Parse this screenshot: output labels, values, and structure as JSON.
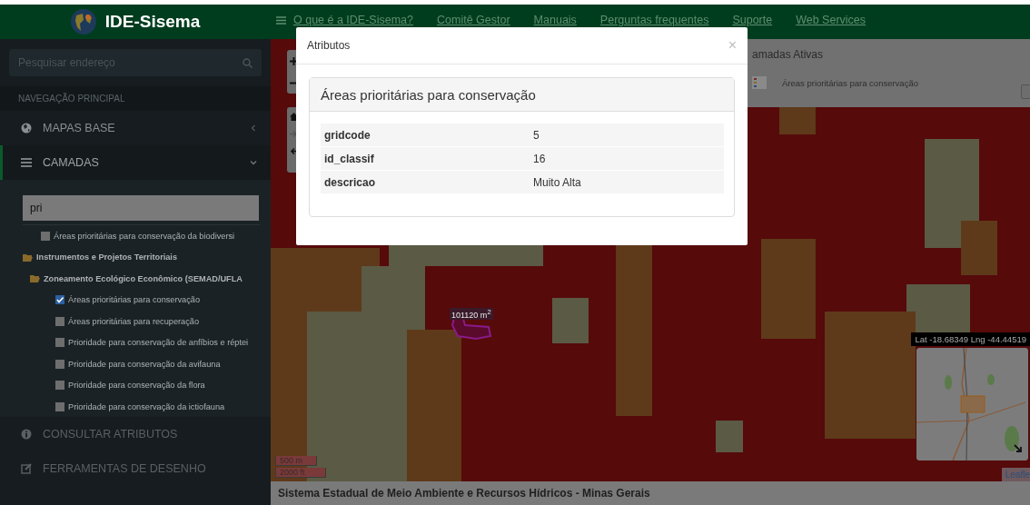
{
  "header": {
    "title": "IDE-Sisema"
  },
  "sidebar": {
    "search": {
      "placeholder": "Pesquisar endereço"
    },
    "section_title": "NAVEGAÇÃO PRINCIPAL",
    "menu": [
      {
        "label": "MAPAS BASE",
        "expanded": false,
        "selected": false
      },
      {
        "label": "CAMADAS",
        "expanded": true,
        "selected": true
      }
    ],
    "layer_filter": {
      "value": "pri"
    },
    "layer_tree": [
      {
        "kind": "layer",
        "label": "Áreas prioritárias para conservação da biodiversi",
        "checked": false
      },
      {
        "kind": "folder",
        "label": "Instrumentos e Projetos Territoriais",
        "children": [
          {
            "kind": "folder",
            "label": "Zoneamento Ecológico Econômico (SEMAD/UFLA",
            "children": [
              {
                "kind": "layer",
                "label": "Áreas prioritárias para conservação",
                "checked": true
              },
              {
                "kind": "layer",
                "label": "Áreas prioritárias para recuperação",
                "checked": false
              },
              {
                "kind": "layer",
                "label": "Prioridade para conservação de anfíbios e réptei",
                "checked": false
              },
              {
                "kind": "layer",
                "label": "Prioridade para conservação da avifauna",
                "checked": false
              },
              {
                "kind": "layer",
                "label": "Prioridade para conservação da flora",
                "checked": false
              },
              {
                "kind": "layer",
                "label": "Prioridade para conservação da ictiofauna",
                "checked": false
              }
            ]
          }
        ]
      }
    ],
    "tools": [
      {
        "label": "CONSULTAR ATRIBUTOS"
      },
      {
        "label": "FERRAMENTAS DE DESENHO"
      }
    ]
  },
  "navbar": {
    "links": [
      "O que é a IDE-Sisema?",
      "Comitê Gestor",
      "Manuais",
      "Perguntas frequentes",
      "Suporte",
      "Web Services"
    ]
  },
  "map": {
    "active_layers": {
      "title": "amadas Ativas",
      "layers": [
        {
          "label": "Áreas prioritárias para conservação"
        }
      ]
    },
    "measurement": "101120 m$^{2}$",
    "coordinates": "Lat -18.68349 Lng -44.44519",
    "scale": [
      "500 m",
      "2000 ft"
    ],
    "attribution": "Leafle"
  },
  "footer": "Sistema Estadual de Meio Ambiente e Recursos Hídricos - Minas Gerais",
  "modal": {
    "title": "Atributos",
    "close": "×",
    "panel_title": "Áreas prioritárias para conservação",
    "rows": [
      {
        "key": "gridcode",
        "value": "5"
      },
      {
        "key": "id_classif",
        "value": "16"
      },
      {
        "key": "descricao",
        "value": "Muito Alta"
      }
    ]
  }
}
